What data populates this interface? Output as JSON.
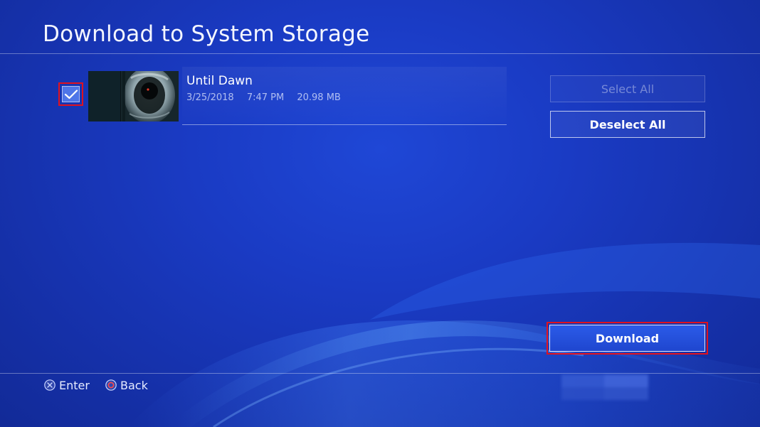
{
  "screen": {
    "title": "Download to System Storage"
  },
  "content_list": {
    "items": [
      {
        "title": "Until Dawn",
        "date": "3/25/2018",
        "time": "7:47 PM",
        "size": "20.98 MB",
        "checked": true,
        "checkbox_icon": "checkmark-icon",
        "thumbnail_icon": "game-thumbnail"
      }
    ]
  },
  "actions": {
    "select_all_label": "Select All",
    "deselect_all_label": "Deselect All",
    "download_label": "Download"
  },
  "footer": {
    "enter_label": "Enter",
    "enter_icon": "cross-button-icon",
    "back_label": "Back",
    "back_icon": "circle-button-icon"
  },
  "colors": {
    "background": "#1a3bc4",
    "focus_outline": "#e0121f",
    "checkbox_fill": "#4f76e8",
    "text": "#ffffff"
  }
}
